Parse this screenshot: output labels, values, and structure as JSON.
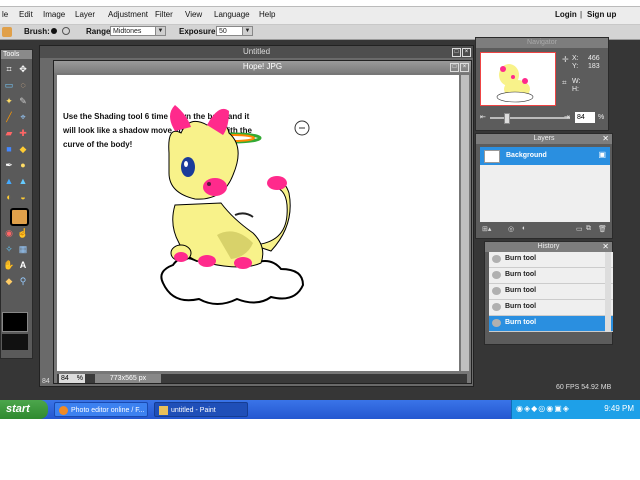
{
  "menu": {
    "items": [
      "le",
      "Edit",
      "Image",
      "Layer",
      "Adjustment",
      "Filter",
      "View",
      "Language",
      "Help"
    ],
    "login": "Login",
    "separator": "|",
    "signup": "Sign up"
  },
  "options": {
    "brush_label": "Brush:",
    "range_label": "Range:",
    "range_value": "Midtones",
    "exposure_label": "Exposure:",
    "exposure_value": "50"
  },
  "tools": {
    "title": "Tools"
  },
  "untitled_window": {
    "title": "Untitled"
  },
  "hope_window": {
    "title": "Hope! JPG"
  },
  "canvas": {
    "caption": "Use the Shading tool 6 time down the back and it will look like a shadow move your mouse with the curve of the body!",
    "zoom": "84",
    "zoom_unit": "%",
    "dimensions": "773x565 px",
    "left_status": "84"
  },
  "navigator": {
    "title": "Navigator",
    "x_label": "X:",
    "x_value": "466",
    "y_label": "Y:",
    "y_value": "183",
    "w_label": "W:",
    "h_label": "H:",
    "zoom_value": "84",
    "zoom_unit": "%"
  },
  "layers": {
    "title": "Layers",
    "items": [
      {
        "name": "Background"
      }
    ]
  },
  "history": {
    "title": "History",
    "items": [
      "Burn tool",
      "Burn tool",
      "Burn tool",
      "Burn tool",
      "Burn tool"
    ],
    "selected_index": 4
  },
  "perf": {
    "text": "60 FPS 54.92 MB"
  },
  "taskbar": {
    "start": "start",
    "tasks": [
      "Photo editor online / F...",
      "untitled - Paint"
    ],
    "clock": "9:49 PM"
  },
  "colors": {
    "accent": "#2a8fe0",
    "taskbar": "#2457d0",
    "start": "#3a9a3a",
    "panel": "#5c5c5c"
  }
}
